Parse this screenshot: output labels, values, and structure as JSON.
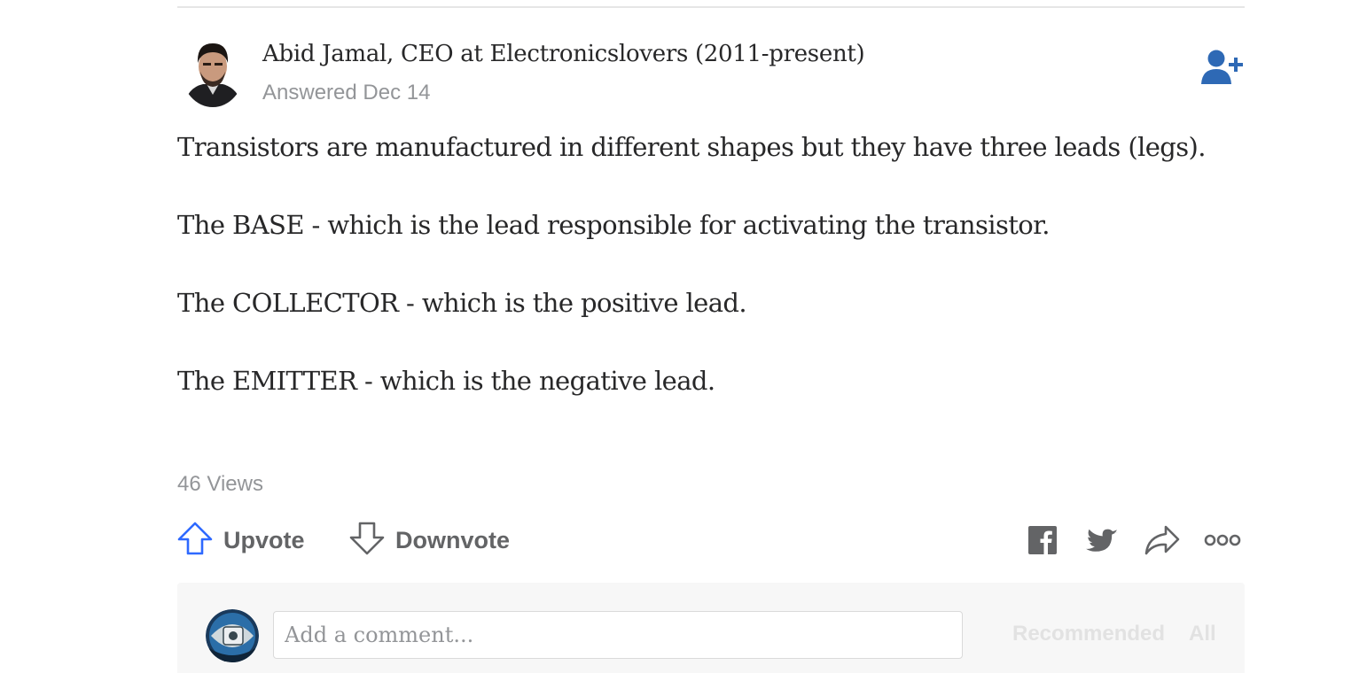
{
  "author": {
    "name_line": "Abid Jamal, CEO at Electronicslovers (2011-present)",
    "answered": "Answered Dec 14",
    "follow_icon": "add-user-icon",
    "follow_color": "#2e69b5"
  },
  "answer": {
    "paragraphs": [
      "Transistors are manufactured in different shapes but they have three leads (legs).",
      "The BASE - which is the lead responsible for activating the transistor.",
      "The COLLECTOR - which is the positive lead.",
      "The EMITTER - which is the negative lead."
    ],
    "views": "46 Views"
  },
  "actions": {
    "upvote_label": "Upvote",
    "downvote_label": "Downvote",
    "upvote_color": "#2e69ff",
    "icons": [
      "facebook-icon",
      "twitter-icon",
      "share-icon",
      "more-icon"
    ]
  },
  "comments": {
    "placeholder": "Add a comment...",
    "sort_recommended": "Recommended",
    "sort_all": "All"
  }
}
